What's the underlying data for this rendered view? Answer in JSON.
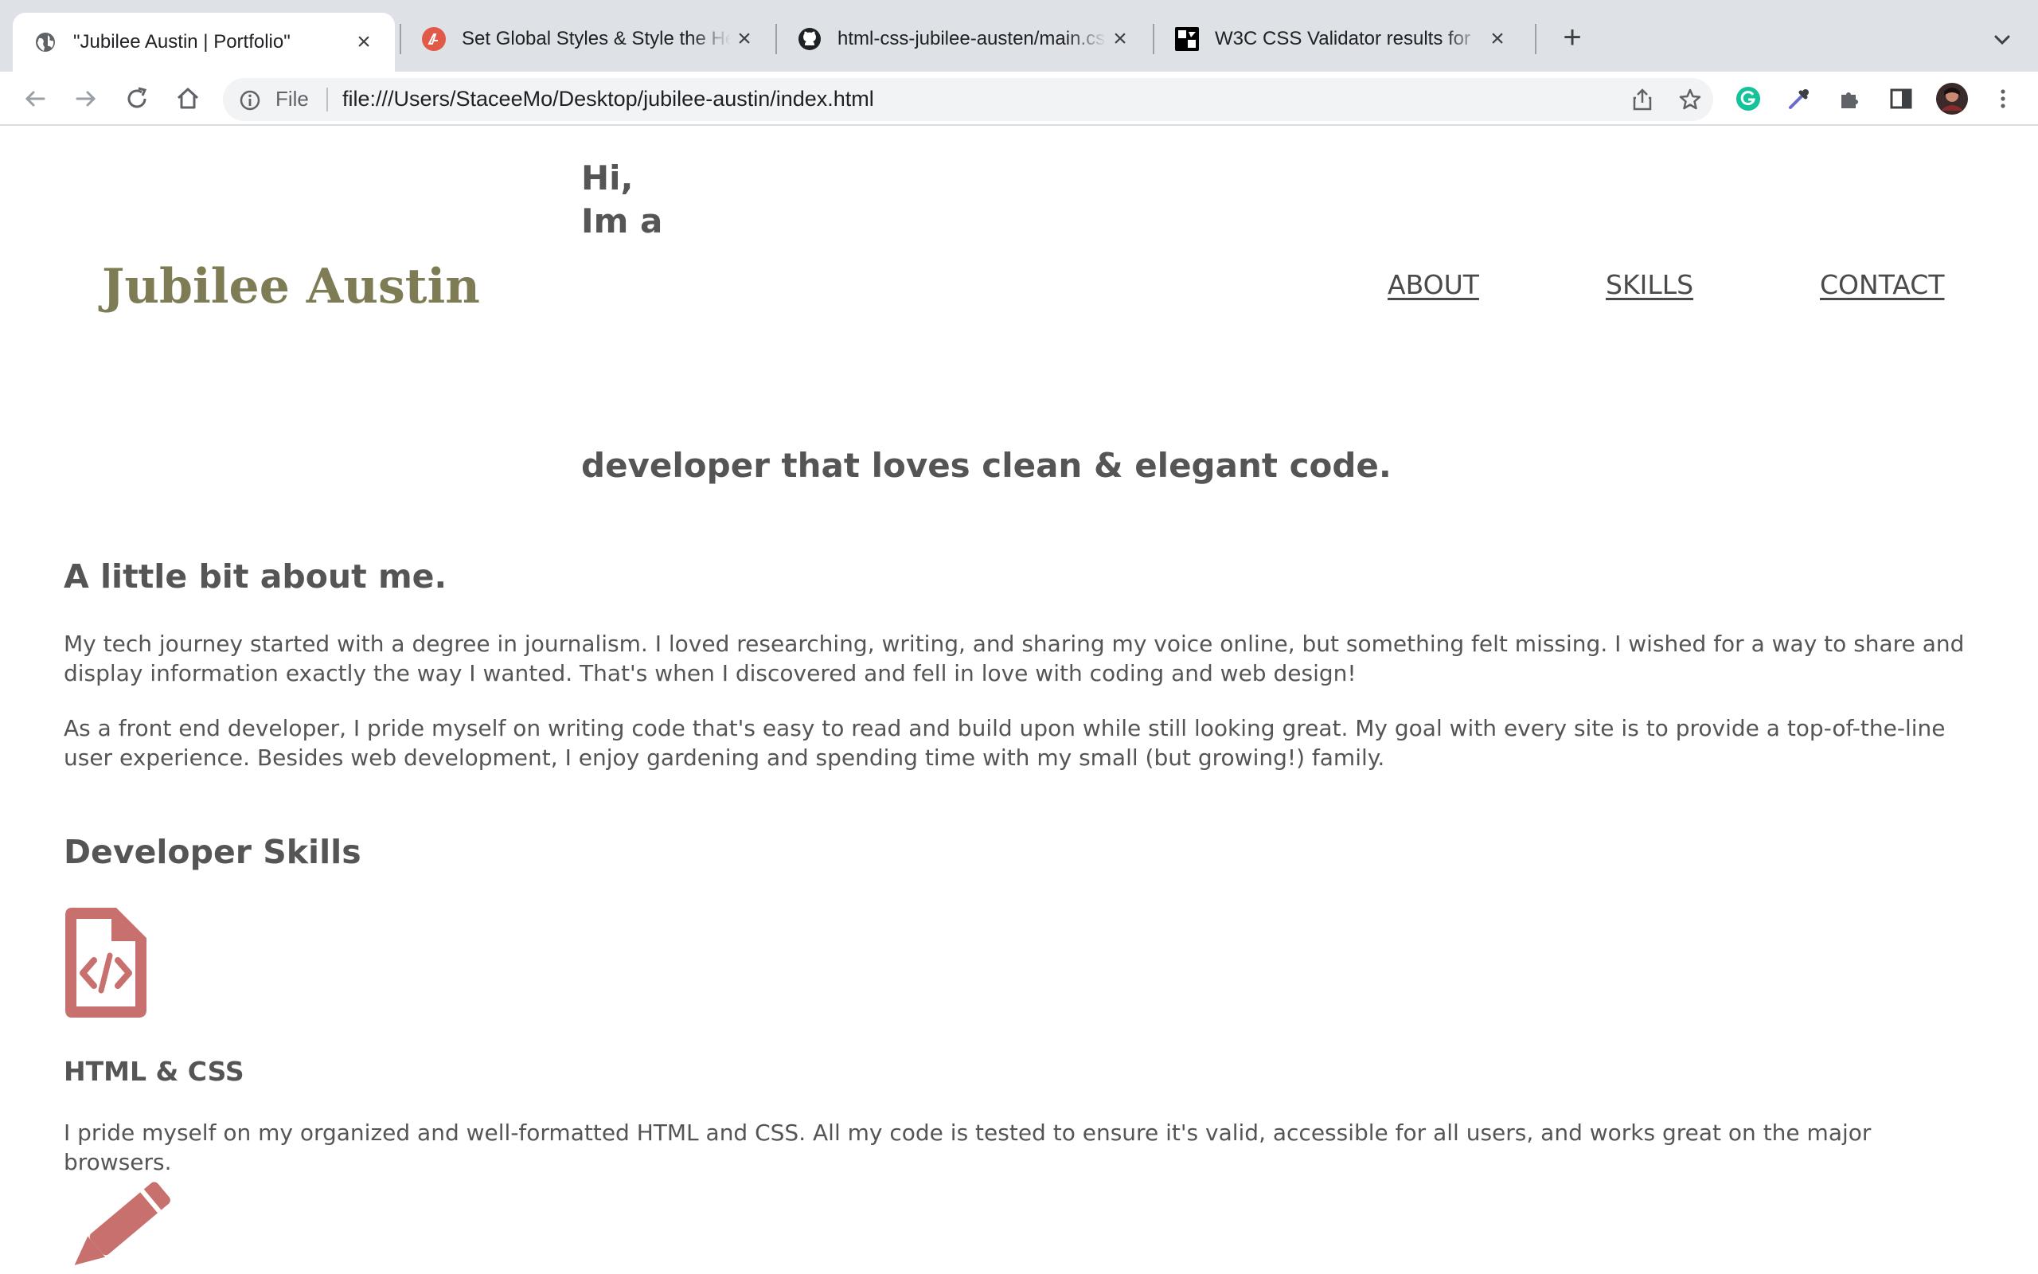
{
  "browser": {
    "tabs": [
      {
        "title": "\"Jubilee Austin | Portfolio\"",
        "icon": "globe-icon",
        "active": true
      },
      {
        "title": "Set Global Styles & Style the Header",
        "icon": "bootcamp-favicon-icon",
        "active": false
      },
      {
        "title": "html-css-jubilee-austen/main.css",
        "icon": "github-icon",
        "active": false
      },
      {
        "title": "W3C CSS Validator results for",
        "icon": "w3c-icon",
        "active": false
      }
    ],
    "new_tab_label": "+",
    "omnibox": {
      "scheme_label": "File",
      "url": "file:///Users/StaceeMo/Desktop/jubilee-austin/index.html"
    }
  },
  "site": {
    "brand": "Jubilee Austin",
    "greeting_line1": "Hi,",
    "greeting_line2": "Im a",
    "tagline": "developer that loves clean & elegant code.",
    "nav": [
      {
        "label": "ABOUT"
      },
      {
        "label": "SKILLS"
      },
      {
        "label": "CONTACT"
      }
    ],
    "about": {
      "heading": "A little bit about me.",
      "paragraph1": "My tech journey started with a degree in journalism. I loved researching, writing, and sharing my voice online, but something felt missing. I wished for a way to share and display information exactly the way I wanted. That's when I discovered and fell in love with coding and web design!",
      "paragraph2": "As a front end developer, I pride myself on writing code that's easy to read and build upon while still looking great. My goal with every site is to provide a top-of-the-line user experience. Besides web development, I enjoy gardening and spending time with my small (but growing!) family."
    },
    "skills": {
      "heading": "Developer Skills",
      "items": [
        {
          "title": "HTML & CSS",
          "icon": "code-file-icon",
          "description": "I pride myself on my organized and well-formatted HTML and CSS. All my code is tested to ensure it's valid, accessible for all users, and works great on the major browsers."
        },
        {
          "title": "",
          "icon": "pencil-icon",
          "description": ""
        }
      ]
    }
  },
  "colors": {
    "brand": "#7d7c55",
    "accent_icon": "#c8706d",
    "text": "#555555"
  }
}
